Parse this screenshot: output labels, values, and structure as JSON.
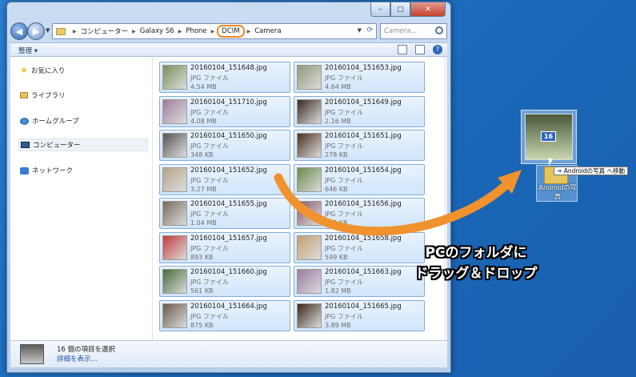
{
  "window": {
    "caption": {
      "min_glyph": "‒",
      "max_glyph": "□",
      "close_glyph": "✕"
    }
  },
  "address": {
    "crumbs": [
      "コンピューター",
      "Galaxy S6",
      "Phone",
      "DCIM",
      "Camera"
    ],
    "search_placeholder": "Camera..."
  },
  "toolbar": {
    "organize_label": "整理 ▾",
    "help_glyph": "?"
  },
  "nav": {
    "favorites": "お気に入り",
    "libraries": "ライブラリ",
    "homegroup": "ホームグループ",
    "computer": "コンピューター",
    "network": "ネットワーク"
  },
  "files": [
    {
      "name": "20160104_151648.jpg",
      "type": "JPG ファイル",
      "size": "4.54 MB",
      "color": "#7b8f5a"
    },
    {
      "name": "20160104_151653.jpg",
      "type": "JPG ファイル",
      "size": "4.64 MB",
      "color": "#8f9a78"
    },
    {
      "name": "20160104_151710.jpg",
      "type": "JPG ファイル",
      "size": "4.08 MB",
      "color": "#a07f9f"
    },
    {
      "name": "20160104_151649.jpg",
      "type": "JPG ファイル",
      "size": "2.16 MB",
      "color": "#3a2a20"
    },
    {
      "name": "20160104_151650.jpg",
      "type": "JPG ファイル",
      "size": "348 KB",
      "color": "#555555"
    },
    {
      "name": "20160104_151651.jpg",
      "type": "JPG ファイル",
      "size": "278 KB",
      "color": "#4a3020"
    },
    {
      "name": "20160104_151652.jpg",
      "type": "JPG ファイル",
      "size": "3.27 MB",
      "color": "#b5a58a"
    },
    {
      "name": "20160104_151654.jpg",
      "type": "JPG ファイル",
      "size": "646 KB",
      "color": "#6a8a4a"
    },
    {
      "name": "20160104_151655.jpg",
      "type": "JPG ファイル",
      "size": "1.04 MB",
      "color": "#7a6a5a"
    },
    {
      "name": "20160104_151656.jpg",
      "type": "JPG ファイル",
      "size": "753 KB",
      "color": "#8a5a6a"
    },
    {
      "name": "20160104_151657.jpg",
      "type": "JPG ファイル",
      "size": "893 KB",
      "color": "#c33a3a"
    },
    {
      "name": "20160104_151658.jpg",
      "type": "JPG ファイル",
      "size": "599 KB",
      "color": "#c7a070"
    },
    {
      "name": "20160104_151660.jpg",
      "type": "JPG ファイル",
      "size": "561 KB",
      "color": "#4a6a3a"
    },
    {
      "name": "20160104_151663.jpg",
      "type": "JPG ファイル",
      "size": "1.82 MB",
      "color": "#9a7aa0"
    },
    {
      "name": "20160104_151664.jpg",
      "type": "JPG ファイル",
      "size": "875 KB",
      "color": "#6a5a4a"
    },
    {
      "name": "20160104_151665.jpg",
      "type": "JPG ファイル",
      "size": "3.89 MB",
      "color": "#3a2a1a"
    }
  ],
  "details": {
    "count": "16 個の項目を選択",
    "more": "詳細を表示..."
  },
  "drag": {
    "badge": "16",
    "tooltip_action": "Androidの写真 へ移動",
    "target_label": "Androidの写真"
  },
  "annotation": {
    "line1": "PCのフォルダに",
    "line2": "ドラッグ＆ドロップ"
  },
  "colors": {
    "accent_orange": "#f0922e",
    "selection_blue": "#84acdd"
  }
}
